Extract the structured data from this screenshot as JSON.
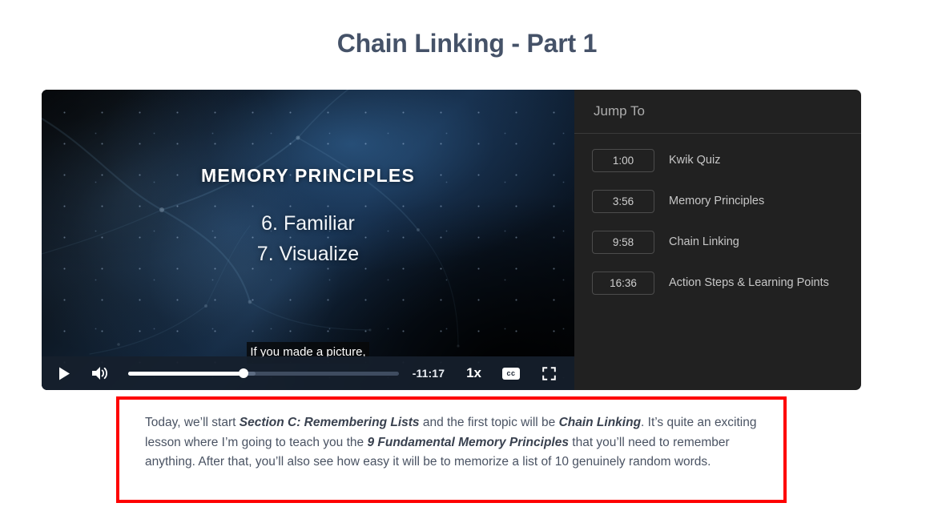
{
  "page": {
    "title": "Chain Linking - Part 1",
    "title_color": "#455268"
  },
  "video": {
    "slide": {
      "heading": "MEMORY PRINCIPLES",
      "line_1": "6. Familiar",
      "line_2": "7. Visualize"
    },
    "caption": "If you made a picture,",
    "controls": {
      "play_label": "play-icon",
      "volume_label": "volume-icon",
      "time_remaining": "-11:17",
      "speed": "1x",
      "cc": "cc",
      "fullscreen_label": "fullscreen-icon",
      "progress_played_percent": 42.5,
      "progress_buffered_percent": 47
    }
  },
  "jump_to": {
    "header": "Jump To",
    "items": [
      {
        "time": "1:00",
        "label": "Kwik Quiz"
      },
      {
        "time": "3:56",
        "label": "Memory Principles"
      },
      {
        "time": "9:58",
        "label": "Chain Linking"
      },
      {
        "time": "16:36",
        "label": "Action Steps & Learning Points"
      }
    ]
  },
  "description": {
    "highlight_color": "#fe0000",
    "segments": [
      {
        "text": "Today, we’ll start ",
        "bold": false
      },
      {
        "text": "Section C: Remembering Lists",
        "bold": true
      },
      {
        "text": " and the first topic will be ",
        "bold": false
      },
      {
        "text": "Chain Linking",
        "bold": true
      },
      {
        "text": ". It’s quite an exciting lesson where I’m going to teach you the ",
        "bold": false
      },
      {
        "text": "9 Fundamental Memory Principles",
        "bold": true
      },
      {
        "text": " that you’ll need to remember anything. After that, you’ll also see how easy it will be to memorize a list of 10 genuinely random words.",
        "bold": false
      }
    ]
  }
}
